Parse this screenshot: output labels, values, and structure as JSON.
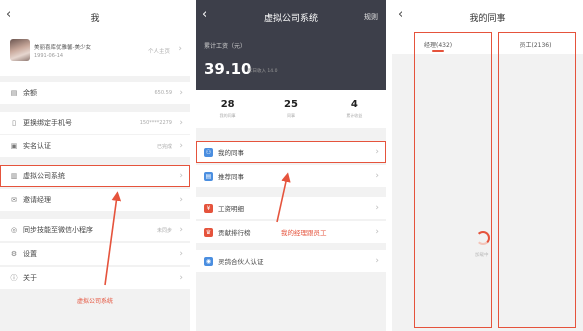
{
  "panel1": {
    "title": "我",
    "profile": {
      "name": "美丽喜库优雅馨-美少女",
      "date": "1991-06-14",
      "home_label": "个人主页"
    },
    "rows": [
      {
        "icon": "wallet-icon",
        "glyph": "▤",
        "label": "余额",
        "value": "650.59"
      },
      {
        "icon": "phone-icon",
        "glyph": "▯",
        "label": "更换绑定手机号",
        "value": "150****2279"
      },
      {
        "icon": "id-card-icon",
        "glyph": "▣",
        "label": "实名认证",
        "value": "已完成"
      },
      {
        "icon": "company-icon",
        "glyph": "▥",
        "label": "虚拟公司系统",
        "value": ""
      },
      {
        "icon": "invite-icon",
        "glyph": "✉",
        "label": "邀请经理",
        "value": ""
      },
      {
        "icon": "wechat-icon",
        "glyph": "◎",
        "label": "同步技能至微信小程序",
        "value": "未同步"
      },
      {
        "icon": "settings-icon",
        "glyph": "⚙",
        "label": "设置",
        "value": ""
      },
      {
        "icon": "about-icon",
        "glyph": "ⓘ",
        "label": "关于",
        "value": ""
      }
    ],
    "footer_link": "虚拟公司系统"
  },
  "panel2": {
    "title": "虚拟公司系统",
    "right_action": "规则",
    "income_label": "累计工资（元）",
    "income_value": "39.10",
    "income_sub": "昨日收入 14.0",
    "stats": [
      {
        "num": "28",
        "label": "我的同事"
      },
      {
        "num": "25",
        "label": "同事"
      },
      {
        "num": "4",
        "label": "累计收益"
      }
    ],
    "rows": [
      {
        "icon": "org-icon",
        "color": "#4a8ee0",
        "glyph": "⚇",
        "label": "我的同事"
      },
      {
        "icon": "recommend-icon",
        "color": "#4a8ee0",
        "glyph": "▤",
        "label": "推荐同事"
      },
      {
        "icon": "salary-icon",
        "color": "#e5533c",
        "glyph": "¥",
        "label": "工资明细"
      },
      {
        "icon": "rank-icon",
        "color": "#e5533c",
        "glyph": "♛",
        "label": "贡献排行榜",
        "extra": "我的经理跟员工"
      },
      {
        "icon": "partner-icon",
        "color": "#4a8ee0",
        "glyph": "◉",
        "label": "灵鸽合伙人认证"
      }
    ]
  },
  "panel3": {
    "title": "我的同事",
    "tabs": [
      "经理(432)",
      "员工(2136)"
    ],
    "loading_text": "加载中"
  },
  "colors": {
    "accent": "#e5533c",
    "dark_header": "#3d3f4a",
    "blue_icon": "#4a8ee0"
  }
}
